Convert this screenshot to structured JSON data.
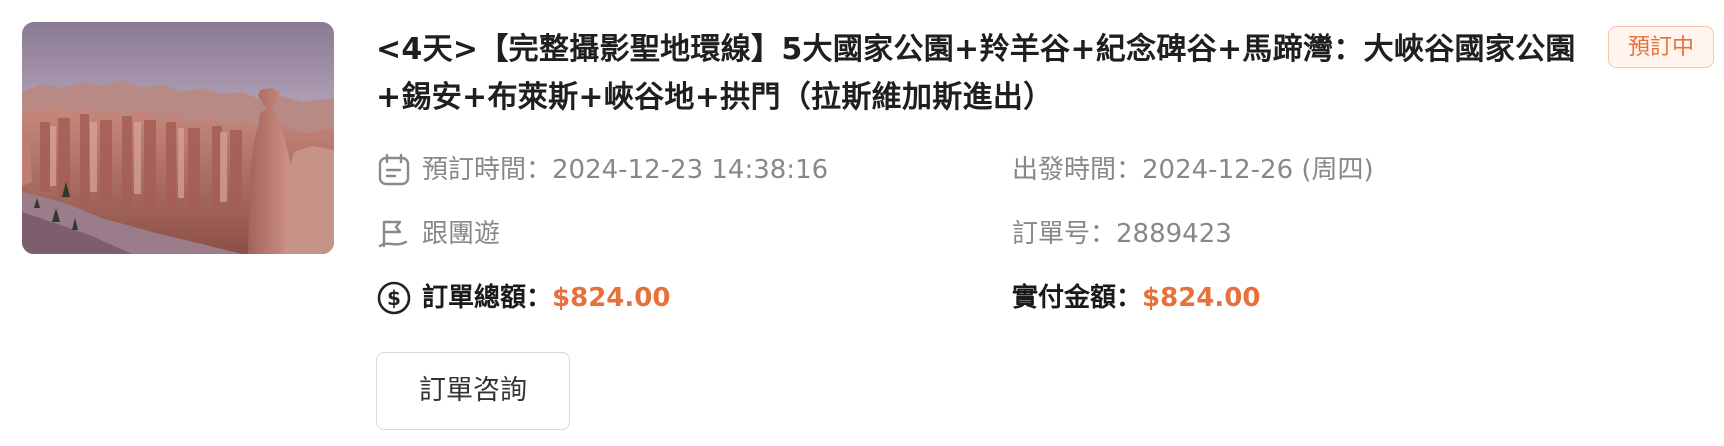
{
  "order": {
    "title": "<4天>【完整攝影聖地環線】5大國家公園+羚羊谷+紀念碑谷+馬蹄灣：大峽谷國家公園+錫安+布萊斯+峽谷地+拱門（拉斯維加斯進出）",
    "status": "預訂中",
    "booking_time_label": "預訂時間：",
    "booking_time_value": "2024-12-23 14:38:16",
    "departure_time_label": "出發時間：",
    "departure_time_value": "2024-12-26 (周四)",
    "tour_type": "跟團遊",
    "order_no_label": "訂單号：",
    "order_no_value": "2889423",
    "total_label": "訂單總額：",
    "total_value": "$824.00",
    "paid_label": "實付金額：",
    "paid_value": "$824.00",
    "consult_button": "訂單咨詢"
  },
  "colors": {
    "accent": "#e8703a",
    "badge_bg": "#fff5ee",
    "muted_text": "#888888"
  },
  "icons": {
    "booking": "calendar-note-icon",
    "tour": "flag-route-icon",
    "total": "dollar-circle-icon",
    "thumbnail": "canyon-photo"
  }
}
